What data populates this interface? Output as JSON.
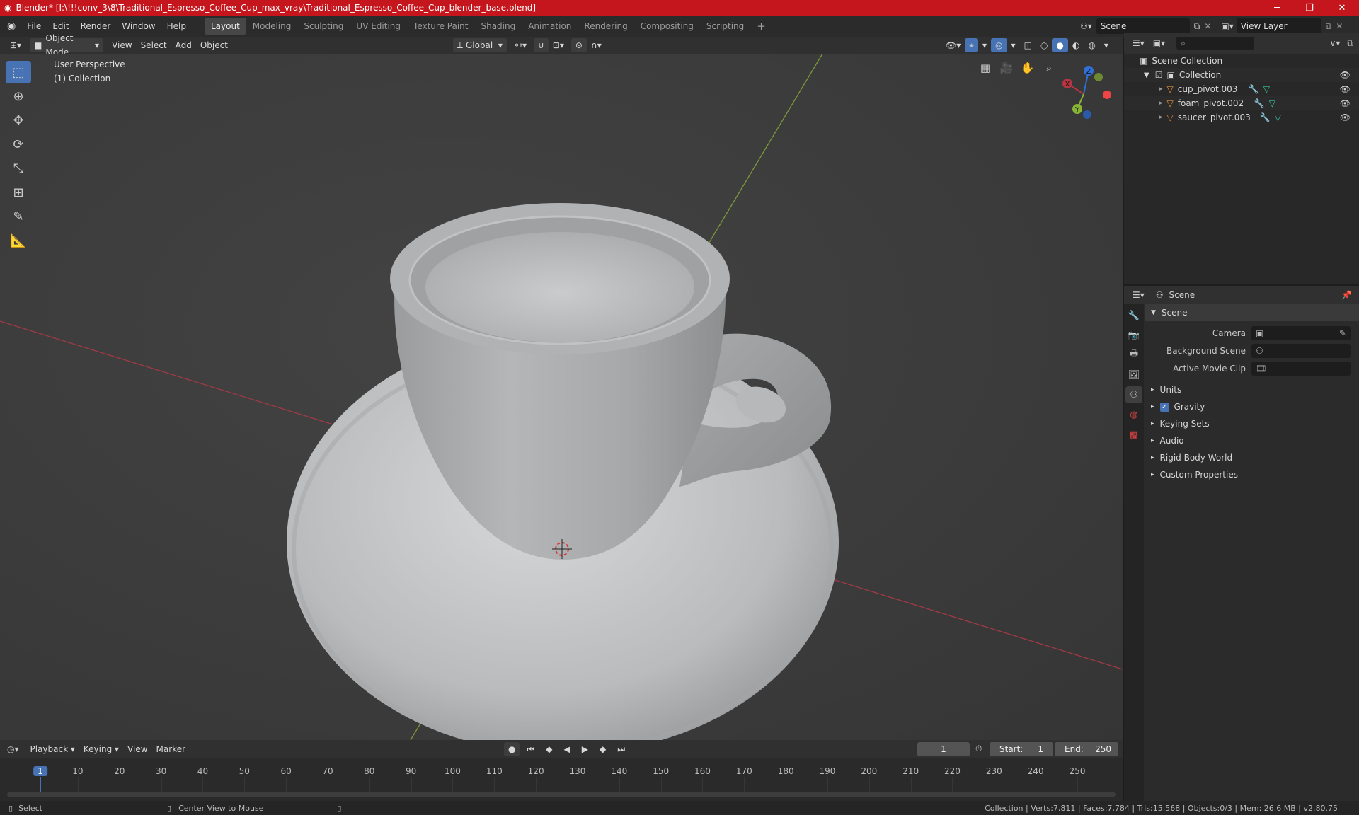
{
  "titlebar": {
    "title": "Blender* [I:\\!!!conv_3\\8\\Traditional_Espresso_Coffee_Cup_max_vray\\Traditional_Espresso_Coffee_Cup_blender_base.blend]",
    "bg": "#c4161c"
  },
  "menubar": {
    "menus": [
      "File",
      "Edit",
      "Render",
      "Window",
      "Help"
    ],
    "workspaces": [
      "Layout",
      "Modeling",
      "Sculpting",
      "UV Editing",
      "Texture Paint",
      "Shading",
      "Animation",
      "Rendering",
      "Compositing",
      "Scripting"
    ],
    "add_tab": "+",
    "scene_field": "Scene",
    "view_layer_field": "View Layer"
  },
  "header3d": {
    "mode": "Object Mode",
    "menus": [
      "View",
      "Select",
      "Add",
      "Object"
    ],
    "transform_orientation": "Global"
  },
  "viewport": {
    "perspective": "User Perspective",
    "collection": "(1) Collection",
    "gizmo": {
      "x": "X",
      "y": "Y",
      "z": "Z"
    }
  },
  "outliner": {
    "search_placeholder": "",
    "root": "Scene Collection",
    "collection": "Collection",
    "objects": [
      {
        "name": "cup_pivot.003"
      },
      {
        "name": "foam_pivot.002"
      },
      {
        "name": "saucer_pivot.003"
      }
    ]
  },
  "properties": {
    "context": "Scene",
    "panel": "Scene",
    "fields": [
      {
        "label": "Camera"
      },
      {
        "label": "Background Scene"
      },
      {
        "label": "Active Movie Clip"
      }
    ],
    "sections": [
      "Units",
      "Gravity",
      "Keying Sets",
      "Audio",
      "Rigid Body World",
      "Custom Properties"
    ],
    "gravity_enabled": true
  },
  "timeline": {
    "menus": [
      "Playback",
      "Keying",
      "View",
      "Marker"
    ],
    "current_frame": "1",
    "start_label": "Start:",
    "start": "1",
    "end_label": "End:",
    "end": "250",
    "ticks": [
      "1",
      "10",
      "20",
      "30",
      "40",
      "50",
      "60",
      "70",
      "80",
      "90",
      "100",
      "110",
      "120",
      "130",
      "140",
      "150",
      "160",
      "170",
      "180",
      "190",
      "200",
      "210",
      "220",
      "230",
      "240",
      "250"
    ]
  },
  "statusbar": {
    "left": "Select",
    "middle": "Center View to Mouse",
    "right": "Collection | Verts:7,811 | Faces:7,784 | Tris:15,568 | Objects:0/3 | Mem: 26.6 MB | v2.80.75"
  },
  "colors": {
    "accent": "#4772b3",
    "x_axis": "#b53541",
    "y_axis": "#87b437",
    "z_axis": "#2f6fd6"
  }
}
